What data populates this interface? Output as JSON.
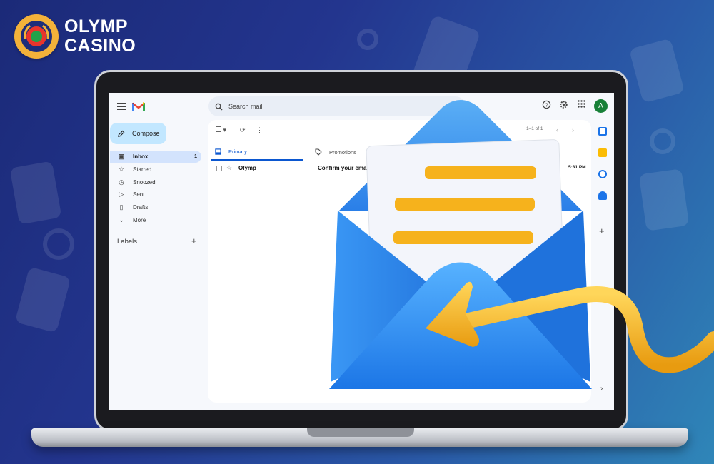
{
  "brand": {
    "line1": "OLYMP",
    "line2": "CASINO"
  },
  "gmail": {
    "search_placeholder": "Search mail",
    "avatar_letter": "A",
    "compose_label": "Compose",
    "nav": [
      {
        "label": "Inbox",
        "count": "1",
        "icon": "inbox-icon"
      },
      {
        "label": "Starred",
        "icon": "star-icon"
      },
      {
        "label": "Snoozed",
        "icon": "clock-icon"
      },
      {
        "label": "Sent",
        "icon": "send-icon"
      },
      {
        "label": "Drafts",
        "icon": "draft-icon"
      },
      {
        "label": "More",
        "icon": "chevron-down-icon"
      }
    ],
    "labels_heading": "Labels",
    "pager": "1–1 of 1",
    "tabs": [
      {
        "label": "Primary",
        "icon": "inbox-icon"
      },
      {
        "label": "Promotions",
        "icon": "tag-icon"
      }
    ],
    "email": {
      "sender": "Olymp",
      "subject": "Confirm your email",
      "time": "5:31 PM"
    }
  },
  "colors": {
    "background_start": "#1b2a78",
    "background_end": "#2f86b8",
    "logo_gold": "#f3b23a",
    "gmail_active": "#d3e3fd",
    "compose": "#c2e7ff",
    "envelope_blue": "#2e8af0",
    "letter_line": "#f6b21c",
    "arrow_gold": "#f5b82a"
  }
}
